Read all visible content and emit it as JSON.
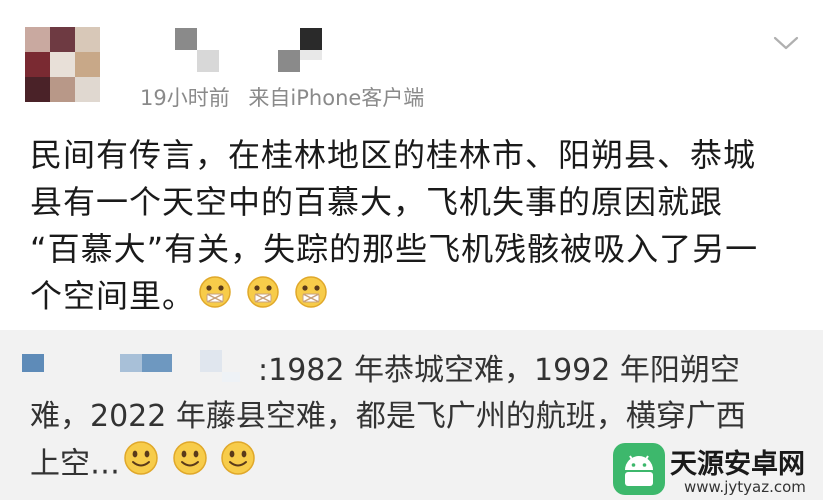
{
  "post": {
    "meta_time": "19小时前",
    "meta_source": "来自iPhone客户端",
    "lines": [
      "民间有传言，在桂林地区的桂林市、阳朔县、恭城",
      "县有一个天空中的百慕大，飞机失事的原因就跟",
      "“百慕大”有关，失踪的那些飞机残骸被吸入了另一",
      "个空间里。"
    ],
    "emoji_icon": "shut-mouth-emoji-icon",
    "emoji_count": 3
  },
  "comment": {
    "lines": [
      ":1982 年恭城空难，1992 年阳朔空",
      "难，2022 年藤县空难，都是飞广州的航班，横穿广西",
      "上空…"
    ],
    "emoji_icon": "smile-emoji-icon",
    "emoji_count": 3
  },
  "watermark": {
    "title": "天源安卓网",
    "url": "www.jytyaz.com",
    "logo_icon": "android-logo-icon"
  },
  "colors": {
    "post_bg": "#ffffff",
    "comment_bg": "#f2f2f2",
    "meta_text": "#8a8a8a",
    "watermark_green": "#3db86c"
  }
}
